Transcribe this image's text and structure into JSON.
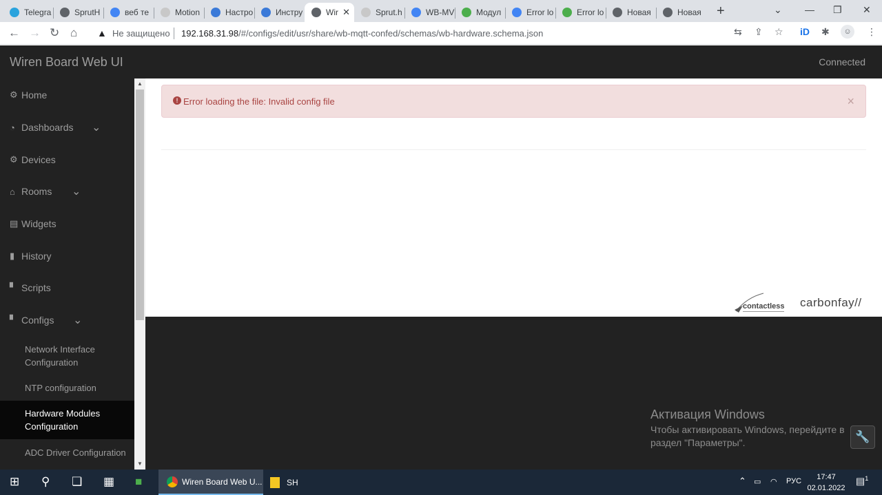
{
  "browser": {
    "tabs": [
      {
        "title": "Telegra",
        "icon": "telegram-icon",
        "color": "#2aa3dd"
      },
      {
        "title": "SprutH",
        "icon": "sprut-icon",
        "color": "#5f6368"
      },
      {
        "title": "веб те",
        "icon": "google-icon",
        "color": "#4285f4"
      },
      {
        "title": "Motion",
        "icon": "motion-icon",
        "color": "#c8c8c8"
      },
      {
        "title": "Настро",
        "icon": "ms-icon",
        "color": "#3b7ad8"
      },
      {
        "title": "Инстру",
        "icon": "ms-icon",
        "color": "#3b7ad8"
      },
      {
        "title": "Wir",
        "icon": "globe-icon",
        "color": "#5f6368",
        "active": true
      },
      {
        "title": "Sprut.h",
        "icon": "sprut-icon",
        "color": "#c8c8c8"
      },
      {
        "title": "WB-MV",
        "icon": "google-icon",
        "color": "#4285f4"
      },
      {
        "title": "Модул",
        "icon": "wb-icon",
        "color": "#4cae4c"
      },
      {
        "title": "Error lo",
        "icon": "google-icon",
        "color": "#4285f4"
      },
      {
        "title": "Error lo",
        "icon": "wb-icon",
        "color": "#4cae4c"
      },
      {
        "title": "Новая",
        "icon": "chrome-icon",
        "color": "#5f6368"
      },
      {
        "title": "Новая",
        "icon": "chrome-icon",
        "color": "#5f6368"
      }
    ],
    "new_tab": "+",
    "insecure_label": "Не защищено",
    "url_host": "192.168.31.98",
    "url_path": "/#/configs/edit/usr/share/wb-mqtt-confed/schemas/wb-hardware.schema.json"
  },
  "app": {
    "brand": "Wiren Board Web UI",
    "status": "Connected"
  },
  "sidebar": {
    "items": [
      {
        "label": "Home",
        "icon": "gear-icon"
      },
      {
        "label": "Dashboards",
        "icon": "dashboard-icon"
      },
      {
        "label": "Devices",
        "icon": "gear-icon"
      },
      {
        "label": "Rooms",
        "icon": "home-icon"
      },
      {
        "label": "Widgets",
        "icon": "list-icon"
      },
      {
        "label": "History",
        "icon": "chart-icon"
      },
      {
        "label": "Scripts",
        "icon": "file-icon"
      },
      {
        "label": "Configs",
        "icon": "file-icon"
      }
    ],
    "config_items": [
      {
        "line1": "Network Interface",
        "line2": "Configuration"
      },
      {
        "line1": "NTP configuration",
        "line2": ""
      },
      {
        "line1": "Hardware Modules",
        "line2": "Configuration",
        "active": true
      },
      {
        "line1": "ADC Driver Configuration",
        "line2": ""
      }
    ]
  },
  "main": {
    "error_message": "Error loading the file: Invalid config file",
    "logos": {
      "contactless": "contactless",
      "carbon": "carbonfay"
    }
  },
  "watermark": {
    "title": "Активация Windows",
    "line1": "Чтобы активировать Windows, перейдите в",
    "line2": "раздел \"Параметры\"."
  },
  "taskbar": {
    "apps": [
      {
        "label": "Wiren Board Web U...",
        "active": true
      },
      {
        "label": "SH",
        "active": false
      }
    ],
    "lang": "РУС",
    "time": "17:47",
    "date": "02.01.2022",
    "notifications": "1"
  }
}
